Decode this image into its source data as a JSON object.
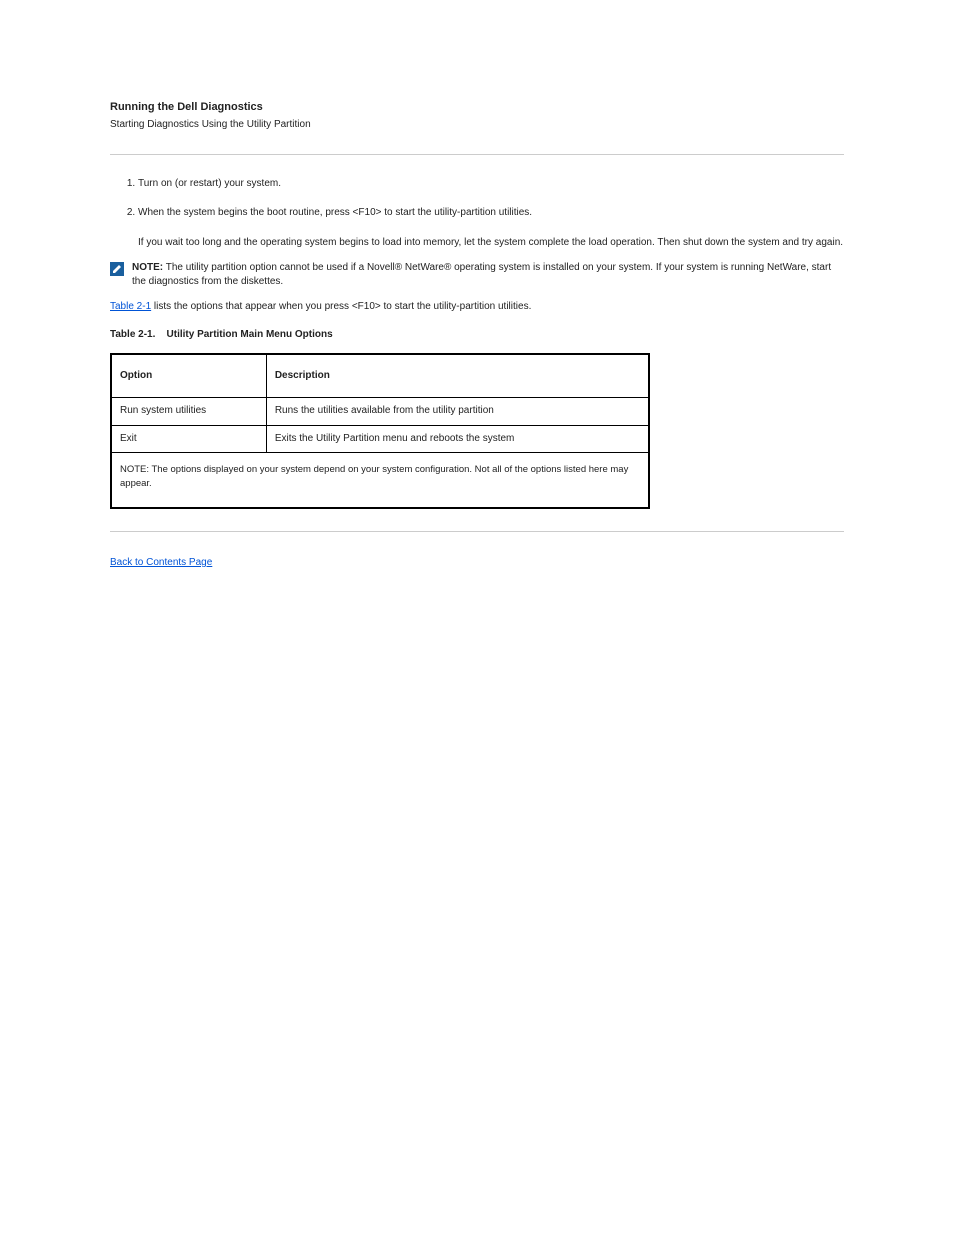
{
  "section": {
    "title": "Running the Dell Diagnostics",
    "subtitle": "Starting Diagnostics Using the Utility Partition"
  },
  "steps": [
    "Turn on (or restart) your system.",
    "When the system begins the boot routine, press <F10> to start the utility-partition utilities."
  ],
  "step2_note": "If you wait too long and the operating system begins to load into memory, let the system complete the load operation. Then shut down the system and try again.",
  "note": {
    "label": "NOTE:",
    "text": " The utility partition option cannot be used if a Novell® NetWare® operating system is installed on your system. If your system is running NetWare, start the diagnostics from the diskettes."
  },
  "table_lead": {
    "link": "Table 2-1",
    "after": " lists the options that appear when you press <F10> to start the utility-partition utilities."
  },
  "table": {
    "caption_num": "Table 2-1.",
    "caption_txt": "Utility Partition Main Menu Options",
    "headers": [
      "Option",
      "Description"
    ],
    "rows": [
      [
        "Run system utilities",
        "Runs the utilities available from the utility partition"
      ],
      [
        "Exit",
        "Exits the Utility Partition menu and reboots the system"
      ]
    ],
    "footer": "NOTE: The options displayed on your system depend on your system configuration. Not all of the options listed here may appear."
  },
  "back_link": "Back to Contents Page"
}
